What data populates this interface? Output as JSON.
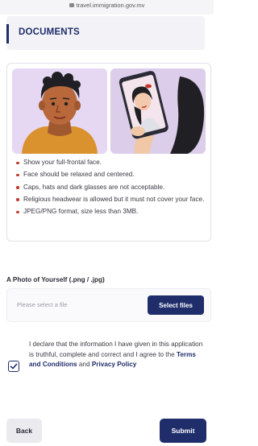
{
  "browser": {
    "url": "travel.immigration.gov.mv"
  },
  "header": {
    "title": "DOCUMENTS"
  },
  "illustrations": {
    "left_icon": "man-portrait-illustration",
    "right_icon": "selfie-phone-illustration"
  },
  "rules": [
    "Show your full-frontal face.",
    "Face should be relaxed and centered.",
    "Caps, hats and dark glasses are not acceptable.",
    "Religious headwear is allowed but it must not cover your face.",
    "JPEG/PNG format, size less than 3MB."
  ],
  "upload": {
    "label": "A Photo of Yourself (.png / .jpg)",
    "placeholder": "Please select a file",
    "button": "Select files"
  },
  "declaration": {
    "checked": true,
    "text_before": "I declare that the information I have given in this application is truthful, complete and correct and I agree to the ",
    "terms_link": "Terms and Conditions",
    "and": " and ",
    "privacy_link": "Privacy Policy"
  },
  "footer": {
    "back": "Back",
    "submit": "Submit"
  },
  "colors": {
    "primary": "#1f2d6b",
    "bullet": "#c0392b",
    "illustration_bg": "#e6d8f2"
  }
}
